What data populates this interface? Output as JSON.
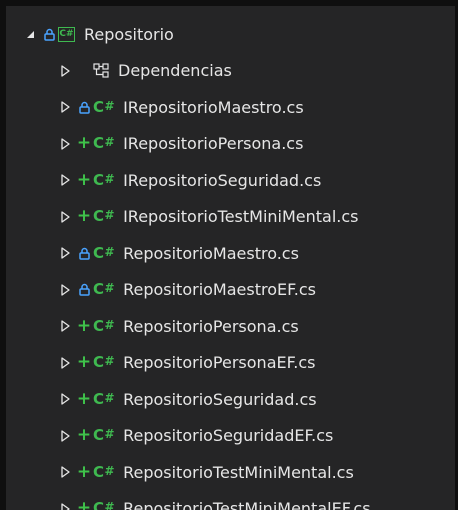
{
  "solution_explorer": {
    "project": {
      "name": "Repositorio",
      "icon": "csharp-project-icon",
      "expanded": true,
      "locked": true
    },
    "items": [
      {
        "label": "Dependencias",
        "icon": "dependencies-icon",
        "status": "none"
      },
      {
        "label": "IRepositorioMaestro.cs",
        "icon": "csharp-file-icon",
        "status": "locked"
      },
      {
        "label": "IRepositorioPersona.cs",
        "icon": "csharp-file-icon",
        "status": "added"
      },
      {
        "label": "IRepositorioSeguridad.cs",
        "icon": "csharp-file-icon",
        "status": "added"
      },
      {
        "label": "IRepositorioTestMiniMental.cs",
        "icon": "csharp-file-icon",
        "status": "added"
      },
      {
        "label": "RepositorioMaestro.cs",
        "icon": "csharp-file-icon",
        "status": "locked"
      },
      {
        "label": "RepositorioMaestroEF.cs",
        "icon": "csharp-file-icon",
        "status": "locked"
      },
      {
        "label": "RepositorioPersona.cs",
        "icon": "csharp-file-icon",
        "status": "added"
      },
      {
        "label": "RepositorioPersonaEF.cs",
        "icon": "csharp-file-icon",
        "status": "added"
      },
      {
        "label": "RepositorioSeguridad.cs",
        "icon": "csharp-file-icon",
        "status": "added"
      },
      {
        "label": "RepositorioSeguridadEF.cs",
        "icon": "csharp-file-icon",
        "status": "added"
      },
      {
        "label": "RepositorioTestMiniMental.cs",
        "icon": "csharp-file-icon",
        "status": "added"
      },
      {
        "label": "RepositorioTestMiniMentalEF.cs",
        "icon": "csharp-file-icon",
        "status": "added"
      }
    ],
    "colors": {
      "background": "#252526",
      "text": "#e6e6e6",
      "csharp_green": "#3fb950",
      "added_green": "#3fc24a",
      "lock_blue": "#4aa3ff"
    }
  }
}
